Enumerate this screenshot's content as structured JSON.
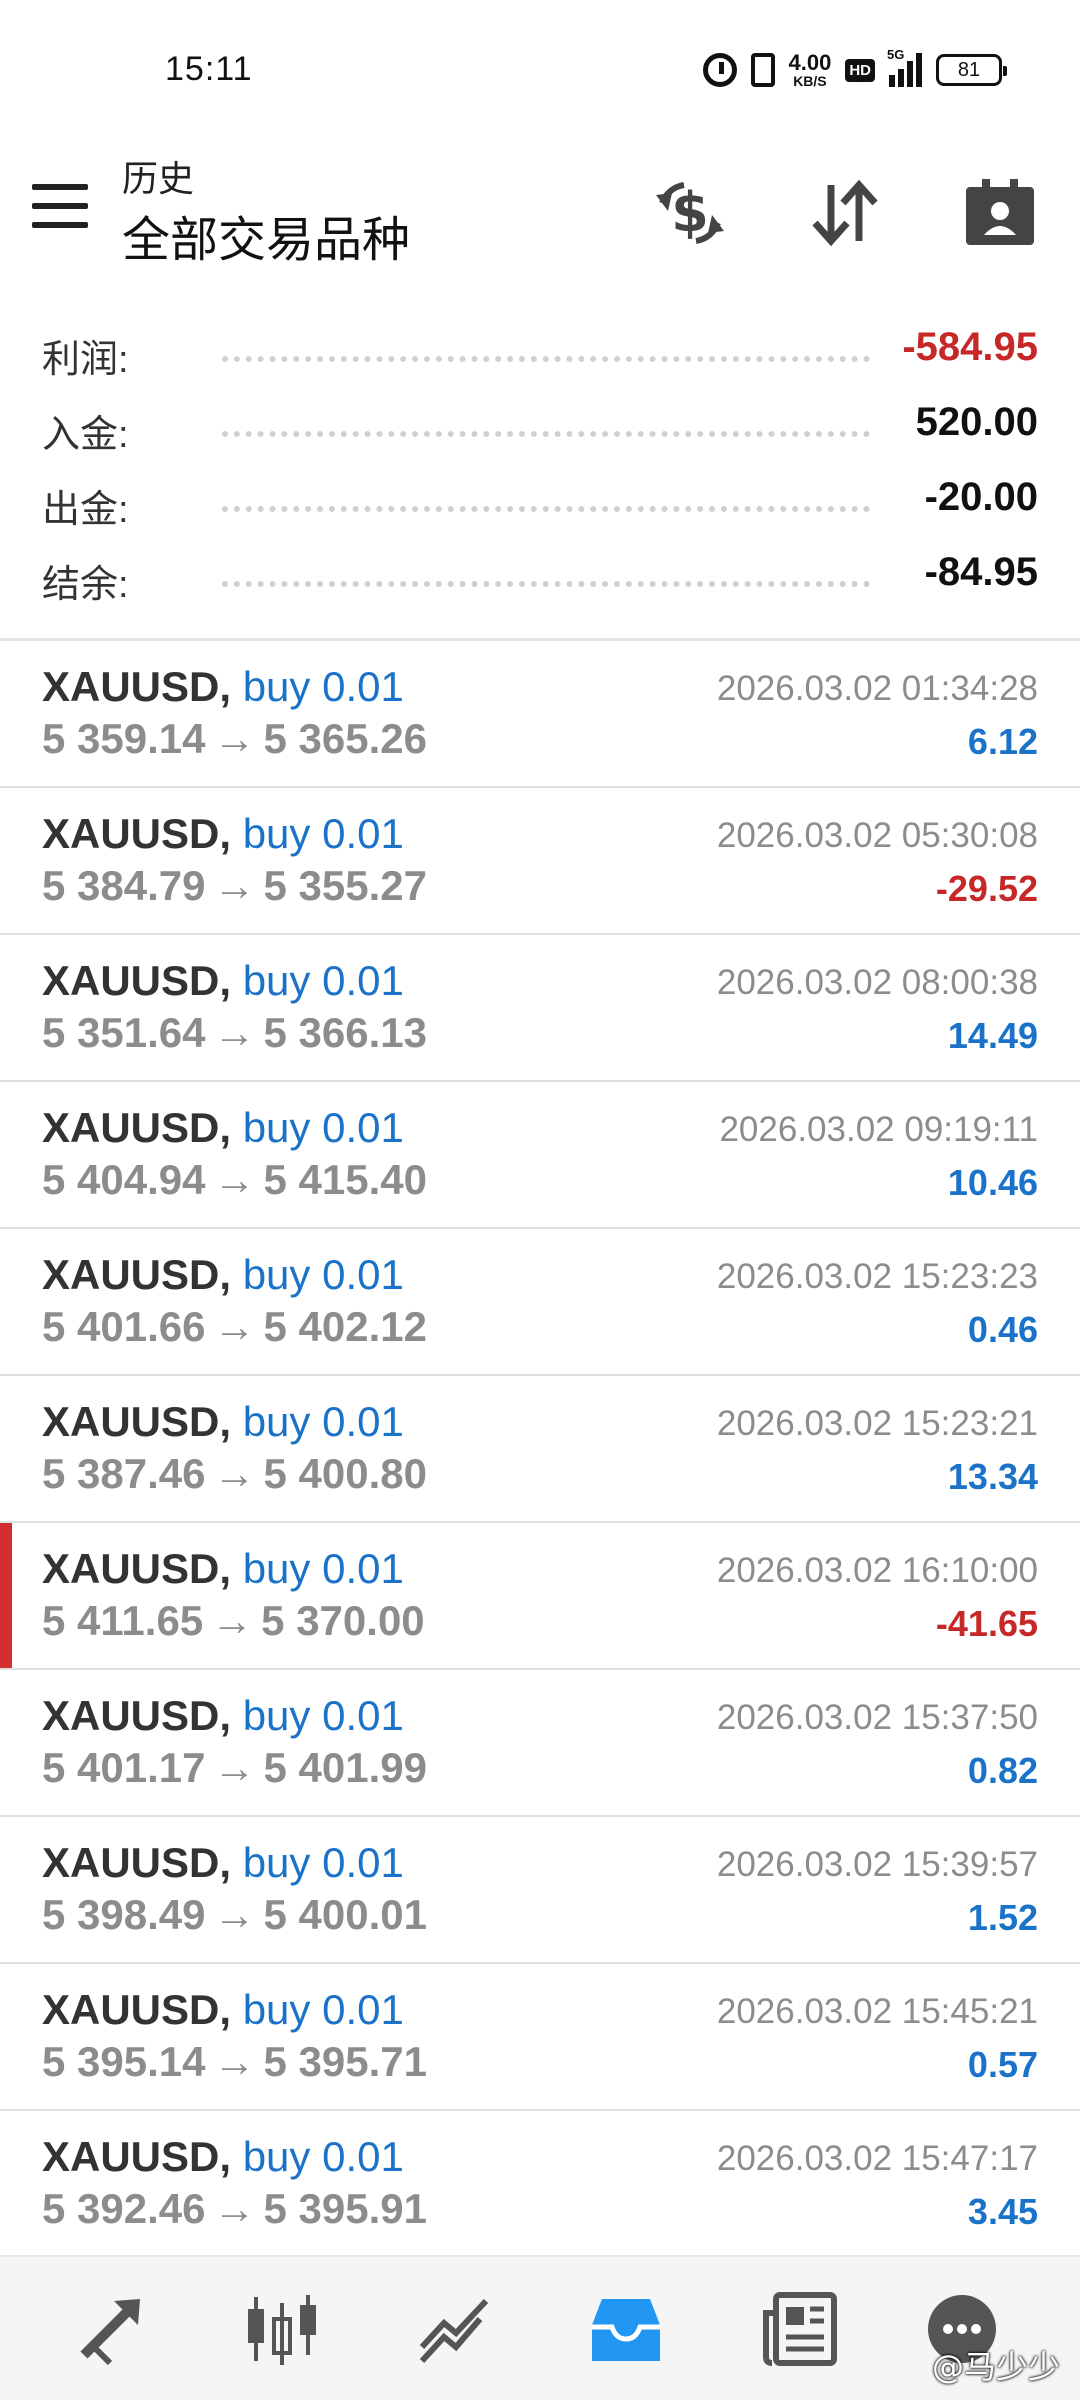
{
  "status_bar": {
    "time": "15:11",
    "net_speed_value": "4.00",
    "net_speed_unit": "KB/S",
    "hd_badge": "HD",
    "network": "5G",
    "battery": "81"
  },
  "header": {
    "subtitle": "历史",
    "title": "全部交易品种",
    "icons": [
      "menu-icon",
      "currency-exchange-icon",
      "sort-icon",
      "contact-card-icon"
    ]
  },
  "summary": [
    {
      "label": "利润:",
      "value": "-584.95",
      "color": "#c62828"
    },
    {
      "label": "入金:",
      "value": "520.00",
      "color": "#111111"
    },
    {
      "label": "出金:",
      "value": "-20.00",
      "color": "#111111"
    },
    {
      "label": "结余:",
      "value": "-84.95",
      "color": "#111111"
    }
  ],
  "trades": [
    {
      "symbol": "XAUUSD,",
      "type": "buy 0.01",
      "open": "5 359.14",
      "arrow": "→",
      "close": "5 365.26",
      "time": "2026.03.02 01:34:28",
      "profit": "6.12"
    },
    {
      "symbol": "XAUUSD,",
      "type": "buy 0.01",
      "open": "5 384.79",
      "arrow": "→",
      "close": "5 355.27",
      "time": "2026.03.02 05:30:08",
      "profit": "-29.52"
    },
    {
      "symbol": "XAUUSD,",
      "type": "buy 0.01",
      "open": "5 351.64",
      "arrow": "→",
      "close": "5 366.13",
      "time": "2026.03.02 08:00:38",
      "profit": "14.49"
    },
    {
      "symbol": "XAUUSD,",
      "type": "buy 0.01",
      "open": "5 404.94",
      "arrow": "→",
      "close": "5 415.40",
      "time": "2026.03.02 09:19:11",
      "profit": "10.46"
    },
    {
      "symbol": "XAUUSD,",
      "type": "buy 0.01",
      "open": "5 401.66",
      "arrow": "→",
      "close": "5 402.12",
      "time": "2026.03.02 15:23:23",
      "profit": "0.46"
    },
    {
      "symbol": "XAUUSD,",
      "type": "buy 0.01",
      "open": "5 387.46",
      "arrow": "→",
      "close": "5 400.80",
      "time": "2026.03.02 15:23:21",
      "profit": "13.34"
    },
    {
      "symbol": "XAUUSD,",
      "type": "buy 0.01",
      "open": "5 411.65",
      "arrow": "→",
      "close": "5 370.00",
      "time": "2026.03.02 16:10:00",
      "profit": "-41.65"
    },
    {
      "symbol": "XAUUSD,",
      "type": "buy 0.01",
      "open": "5 401.17",
      "arrow": "→",
      "close": "5 401.99",
      "time": "2026.03.02 15:37:50",
      "profit": "0.82"
    },
    {
      "symbol": "XAUUSD,",
      "type": "buy 0.01",
      "open": "5 398.49",
      "arrow": "→",
      "close": "5 400.01",
      "time": "2026.03.02 15:39:57",
      "profit": "1.52"
    },
    {
      "symbol": "XAUUSD,",
      "type": "buy 0.01",
      "open": "5 395.14",
      "arrow": "→",
      "close": "5 395.71",
      "time": "2026.03.02 15:45:21",
      "profit": "0.57"
    },
    {
      "symbol": "XAUUSD,",
      "type": "buy 0.01",
      "open": "5 392.46",
      "arrow": "→",
      "close": "5 395.91",
      "time": "2026.03.02 15:47:17",
      "profit": "3.45"
    }
  ],
  "bottom_nav": {
    "items": [
      "quotes-icon",
      "chart-icon",
      "trade-icon",
      "history-icon",
      "news-icon",
      "messages-icon"
    ],
    "active": "history-icon",
    "active_color": "#2196f3",
    "inactive_color": "#555555"
  },
  "watermark": "@马少少"
}
